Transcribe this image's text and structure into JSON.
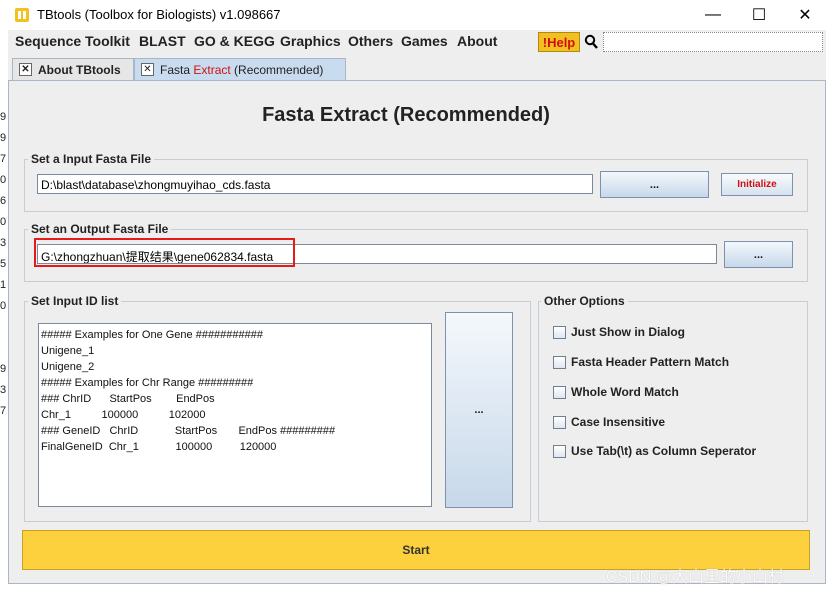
{
  "window": {
    "title": "TBtools (Toolbox for Biologists) v1.098667",
    "minimize_glyph": "—",
    "maximize_glyph": "☐",
    "close_glyph": "✕"
  },
  "menu": {
    "items": [
      "Sequence Toolkit",
      "BLAST",
      "GO & KEGG",
      "Graphics",
      "Others",
      "Games",
      "About"
    ],
    "help_label": "!Help"
  },
  "tabs": {
    "about_label": "About TBtools",
    "fasta_label_prefix": "Fasta ",
    "fasta_label_highlight": "Extract",
    "fasta_label_suffix": " (Recommended)"
  },
  "left_edge_digits": [
    "9",
    "9",
    "7",
    "0",
    "6",
    "0",
    "3",
    "5",
    "1",
    "0",
    "9",
    "3",
    "7"
  ],
  "main": {
    "heading": "Fasta Extract (Recommended)",
    "input_group": {
      "title": "Set a Input Fasta File",
      "value": "D:\\blast\\database\\zhongmuyihao_cds.fasta",
      "browse_label": "...",
      "initialize_label": "Initialize"
    },
    "output_group": {
      "title": "Set an Output Fasta File",
      "value": "G:\\zhongzhuan\\提取结果\\gene062834.fasta",
      "browse_label": "..."
    },
    "id_group": {
      "title": "Set Input ID list",
      "lines": [
        "##### Examples for One Gene ###########",
        "Unigene_1",
        "Unigene_2",
        "##### Examples for Chr Range #########",
        "### ChrID      StartPos        EndPos",
        "Chr_1          100000          102000",
        "### GeneID   ChrID            StartPos       EndPos #########",
        "FinalGeneID  Chr_1            100000         120000"
      ],
      "browse_label": "..."
    },
    "options_group": {
      "title": "Other Options",
      "options": [
        "Just Show in Dialog",
        "Fasta Header Pattern Match",
        "Whole Word Match",
        "Case Insensitive",
        "Use Tab(\\t) as Column Seperator"
      ]
    },
    "start_label": "Start"
  },
  "watermark": "CSDN @大山里的小山村",
  "colors": {
    "start_button": "#fdd03d",
    "help_button": "#f3c021",
    "highlight_red": "#e51a1a",
    "active_tab": "#c9dcef"
  }
}
